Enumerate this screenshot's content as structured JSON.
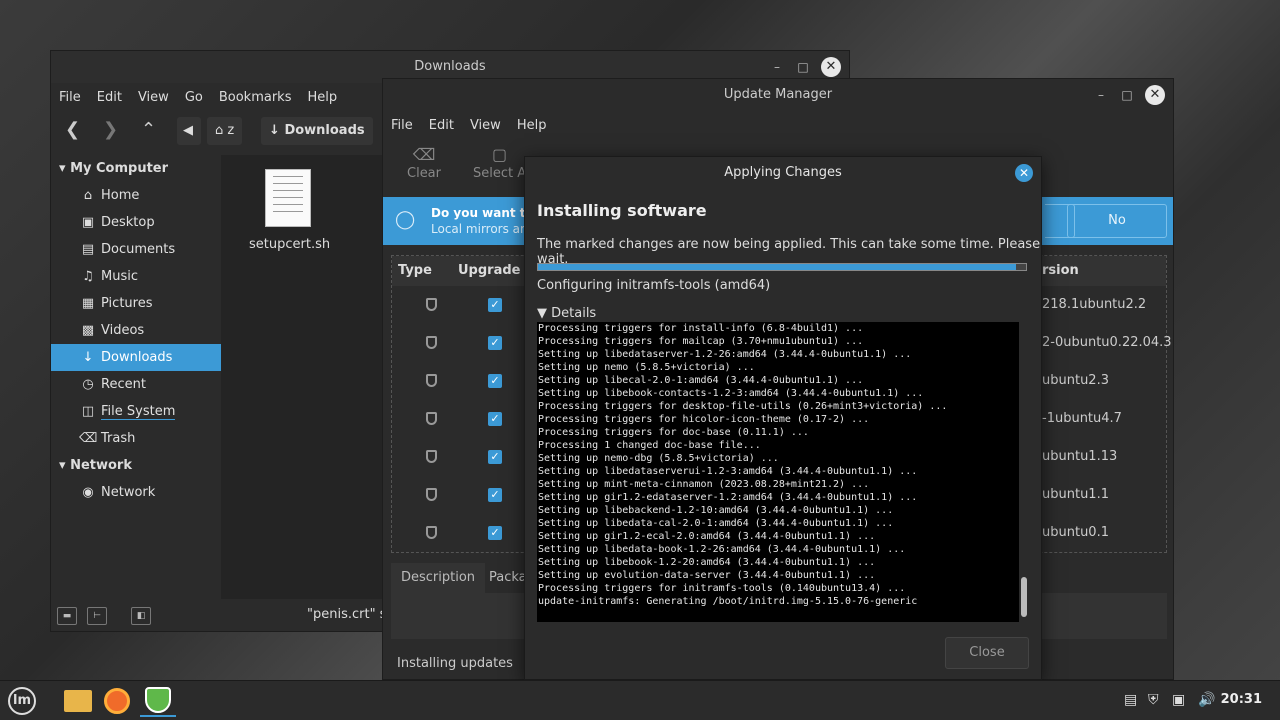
{
  "nemo": {
    "title": "Downloads",
    "menu": [
      "File",
      "Edit",
      "View",
      "Go",
      "Bookmarks",
      "Help"
    ],
    "breadcrumb_home": "z",
    "breadcrumb_current": "Downloads",
    "sidebar": {
      "section1": "My Computer",
      "items": [
        {
          "label": "Home",
          "icon": "home-icon"
        },
        {
          "label": "Desktop",
          "icon": "desktop-icon"
        },
        {
          "label": "Documents",
          "icon": "documents-icon"
        },
        {
          "label": "Music",
          "icon": "music-icon"
        },
        {
          "label": "Pictures",
          "icon": "pictures-icon"
        },
        {
          "label": "Videos",
          "icon": "videos-icon"
        },
        {
          "label": "Downloads",
          "icon": "download-icon"
        },
        {
          "label": "Recent",
          "icon": "clock-icon"
        },
        {
          "label": "File System",
          "icon": "drive-icon"
        },
        {
          "label": "Trash",
          "icon": "trash-icon"
        }
      ],
      "section2": "Network",
      "network_item": "Network"
    },
    "file_name": "setupcert.sh",
    "status_text": "\"penis.crt\" se"
  },
  "update_manager": {
    "title": "Update Manager",
    "menu": [
      "File",
      "Edit",
      "View",
      "Help"
    ],
    "tools": [
      "Clear",
      "Select A"
    ],
    "banner_title": "Do you want to",
    "banner_sub": "Local mirrors ar",
    "banner_no": "No",
    "columns": {
      "type": "Type",
      "upgrade": "Upgrade",
      "version": "rsion"
    },
    "versions": [
      "218.1ubuntu2.2",
      "2-0ubuntu0.22.04.3",
      "ubuntu2.3",
      "-1ubuntu4.7",
      "ubuntu1.13",
      "ubuntu1.1",
      "ubuntu0.1"
    ],
    "tabs": [
      "Description",
      "Packa"
    ],
    "status": "Installing updates"
  },
  "dialog": {
    "title": "Applying Changes",
    "heading": "Installing software",
    "message": "The marked changes are now being applied. This can take some time. Please wait.",
    "progress": 0.98,
    "status": "Configuring initramfs-tools (amd64)",
    "details_label": "Details",
    "close_label": "Close",
    "log": [
      "Processing triggers for install-info (6.8-4build1) ...",
      "Processing triggers for mailcap (3.70+nmu1ubuntu1) ...",
      "Setting up libedataserver-1.2-26:amd64 (3.44.4-0ubuntu1.1) ...",
      "Setting up nemo (5.8.5+victoria) ...",
      "Setting up libecal-2.0-1:amd64 (3.44.4-0ubuntu1.1) ...",
      "Setting up libebook-contacts-1.2-3:amd64 (3.44.4-0ubuntu1.1) ...",
      "Processing triggers for desktop-file-utils (0.26+mint3+victoria) ...",
      "Processing triggers for hicolor-icon-theme (0.17-2) ...",
      "Processing triggers for doc-base (0.11.1) ...",
      "Processing 1 changed doc-base file...",
      "Setting up nemo-dbg (5.8.5+victoria) ...",
      "Setting up libedataserverui-1.2-3:amd64 (3.44.4-0ubuntu1.1) ...",
      "Setting up mint-meta-cinnamon (2023.08.28+mint21.2) ...",
      "Setting up gir1.2-edataserver-1.2:amd64 (3.44.4-0ubuntu1.1) ...",
      "Setting up libebackend-1.2-10:amd64 (3.44.4-0ubuntu1.1) ...",
      "Setting up libedata-cal-2.0-1:amd64 (3.44.4-0ubuntu1.1) ...",
      "Setting up gir1.2-ecal-2.0:amd64 (3.44.4-0ubuntu1.1) ...",
      "Setting up libedata-book-1.2-26:amd64 (3.44.4-0ubuntu1.1) ...",
      "Setting up libebook-1.2-20:amd64 (3.44.4-0ubuntu1.1) ...",
      "Setting up evolution-data-server (3.44.4-0ubuntu1.1) ...",
      "Processing triggers for initramfs-tools (0.140ubuntu13.4) ...",
      "update-initramfs: Generating /boot/initrd.img-5.15.0-76-generic"
    ]
  },
  "taskbar": {
    "clock": "20:31",
    "apps": [
      "folder-icon",
      "firefox-icon",
      "update-manager-shield-icon"
    ]
  }
}
